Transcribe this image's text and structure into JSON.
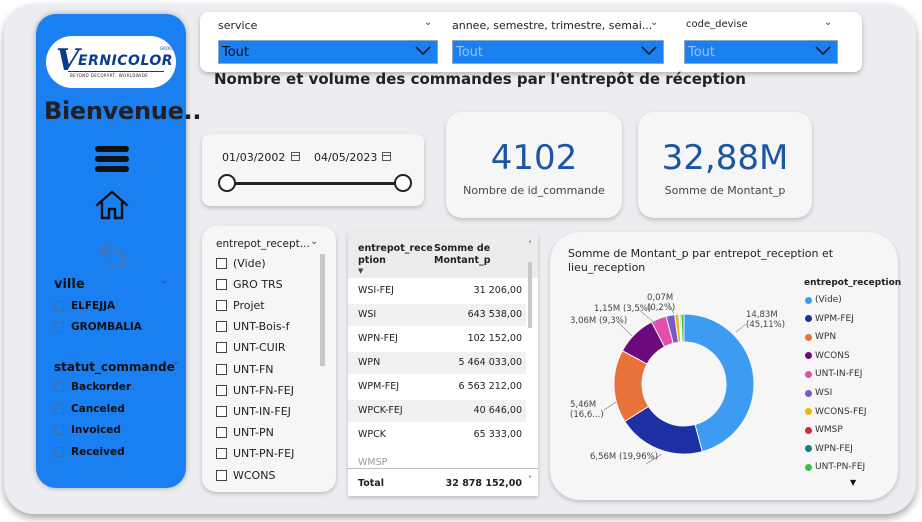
{
  "sidebar": {
    "logo": {
      "v": "V",
      "name": "ERNICOLOR",
      "group": "GROUP",
      "tagline": "BEYOND DECOPART, WORLDWIDE"
    },
    "welcome": "Bienvenue..",
    "ville": {
      "title": "ville",
      "items": [
        "ELFEJJA",
        "GROMBALIA"
      ]
    },
    "statut": {
      "title": "statut_commande",
      "items": [
        "Backorder",
        "Canceled",
        "Invoiced",
        "Received"
      ]
    }
  },
  "filters": [
    {
      "label": "service",
      "value": "Tout",
      "dim": false
    },
    {
      "label": "annee, semestre, trimestre, semai...",
      "value": "Tout",
      "dim": true
    },
    {
      "label": "code_devise",
      "value": "Tout",
      "dim": true
    }
  ],
  "title": "Nombre et volume des commandes par l'entrepôt de réception",
  "date_range": {
    "start": "01/03/2002",
    "end": "04/05/2023"
  },
  "kpis": [
    {
      "value": "4102",
      "label": "Nombre de id_commande"
    },
    {
      "value": "32,88M",
      "label": "Somme de Montant_p"
    }
  ],
  "entrepot_slicer": {
    "title": "entrepot_recept...",
    "items": [
      "(Vide)",
      "GRO TRS",
      "Projet",
      "UNT-Bois-f",
      "UNT-CUIR",
      "UNT-FN",
      "UNT-FN-FEJ",
      "UNT-IN-FEJ",
      "UNT-PN",
      "UNT-PN-FEJ",
      "WCONS"
    ]
  },
  "table": {
    "headers": [
      "entrepot_rece ption",
      "Somme de Montant_p"
    ],
    "header_col1_lines": [
      "entrepot_rece",
      "ption"
    ],
    "header_col2_lines": [
      "Somme de",
      "Montant_p"
    ],
    "rows": [
      [
        "WSI-FEJ",
        "31 206,00"
      ],
      [
        "WSI",
        "643 538,00"
      ],
      [
        "WPN-FEJ",
        "102 152,00"
      ],
      [
        "WPN",
        "5 464 033,00"
      ],
      [
        "WPM-FEJ",
        "6 563 212,00"
      ],
      [
        "WPCK-FEJ",
        "40 646,00"
      ],
      [
        "WPCK",
        "65 333,00"
      ]
    ],
    "total_label": "Total",
    "total_value": "32 878 152,00"
  },
  "chart_data": {
    "type": "pie",
    "title": "Somme de Montant_p par entrepot_reception et lieu_reception",
    "legend_title": "entrepot_reception",
    "legend": [
      "(Vide)",
      "WPM-FEJ",
      "WPN",
      "WCONS",
      "UNT-IN-FEJ",
      "WSI",
      "WCONS-FEJ",
      "WMSP",
      "WPN-FEJ",
      "UNT-PN-FEJ"
    ],
    "slices": [
      {
        "name": "(Vide)",
        "value": 14.83,
        "label": "14,83M (45,11%)",
        "color": "#3d9bf2"
      },
      {
        "name": "WPM-FEJ",
        "value": 6.56,
        "label": "6,56M (19,96%)",
        "color": "#1c2fa3"
      },
      {
        "name": "WPN",
        "value": 5.46,
        "label": "5,46M (16,6...)",
        "color": "#e8733a"
      },
      {
        "name": "WCONS",
        "value": 3.06,
        "label": "3,06M (9,3%)",
        "color": "#6c0a7d"
      },
      {
        "name": "UNT-IN-FEJ",
        "value": 1.15,
        "label": "1,15M (3,5%)",
        "color": "#e44fa8"
      },
      {
        "name": "WSI",
        "value": 0.64,
        "label": "",
        "color": "#7a58c8"
      },
      {
        "name": "WCONS-FEJ",
        "value": 0.3,
        "label": "",
        "color": "#e7b90f"
      },
      {
        "name": "WMSP",
        "value": 0.07,
        "label": "0,07M (0,2%)",
        "color": "#d12b3c"
      },
      {
        "name": "WPN-FEJ",
        "value": 0.1,
        "label": "",
        "color": "#157d7a"
      },
      {
        "name": "UNT-PN-FEJ",
        "value": 0.22,
        "label": "",
        "color": "#35c24a"
      }
    ],
    "extra_labels": [
      "(0,2%)"
    ],
    "legend_colors": [
      "#3d9bf2",
      "#1c2fa3",
      "#e8733a",
      "#6c0a7d",
      "#e44fa8",
      "#7a58c8",
      "#e7b90f",
      "#d12b3c",
      "#157d7a",
      "#35c24a"
    ]
  }
}
